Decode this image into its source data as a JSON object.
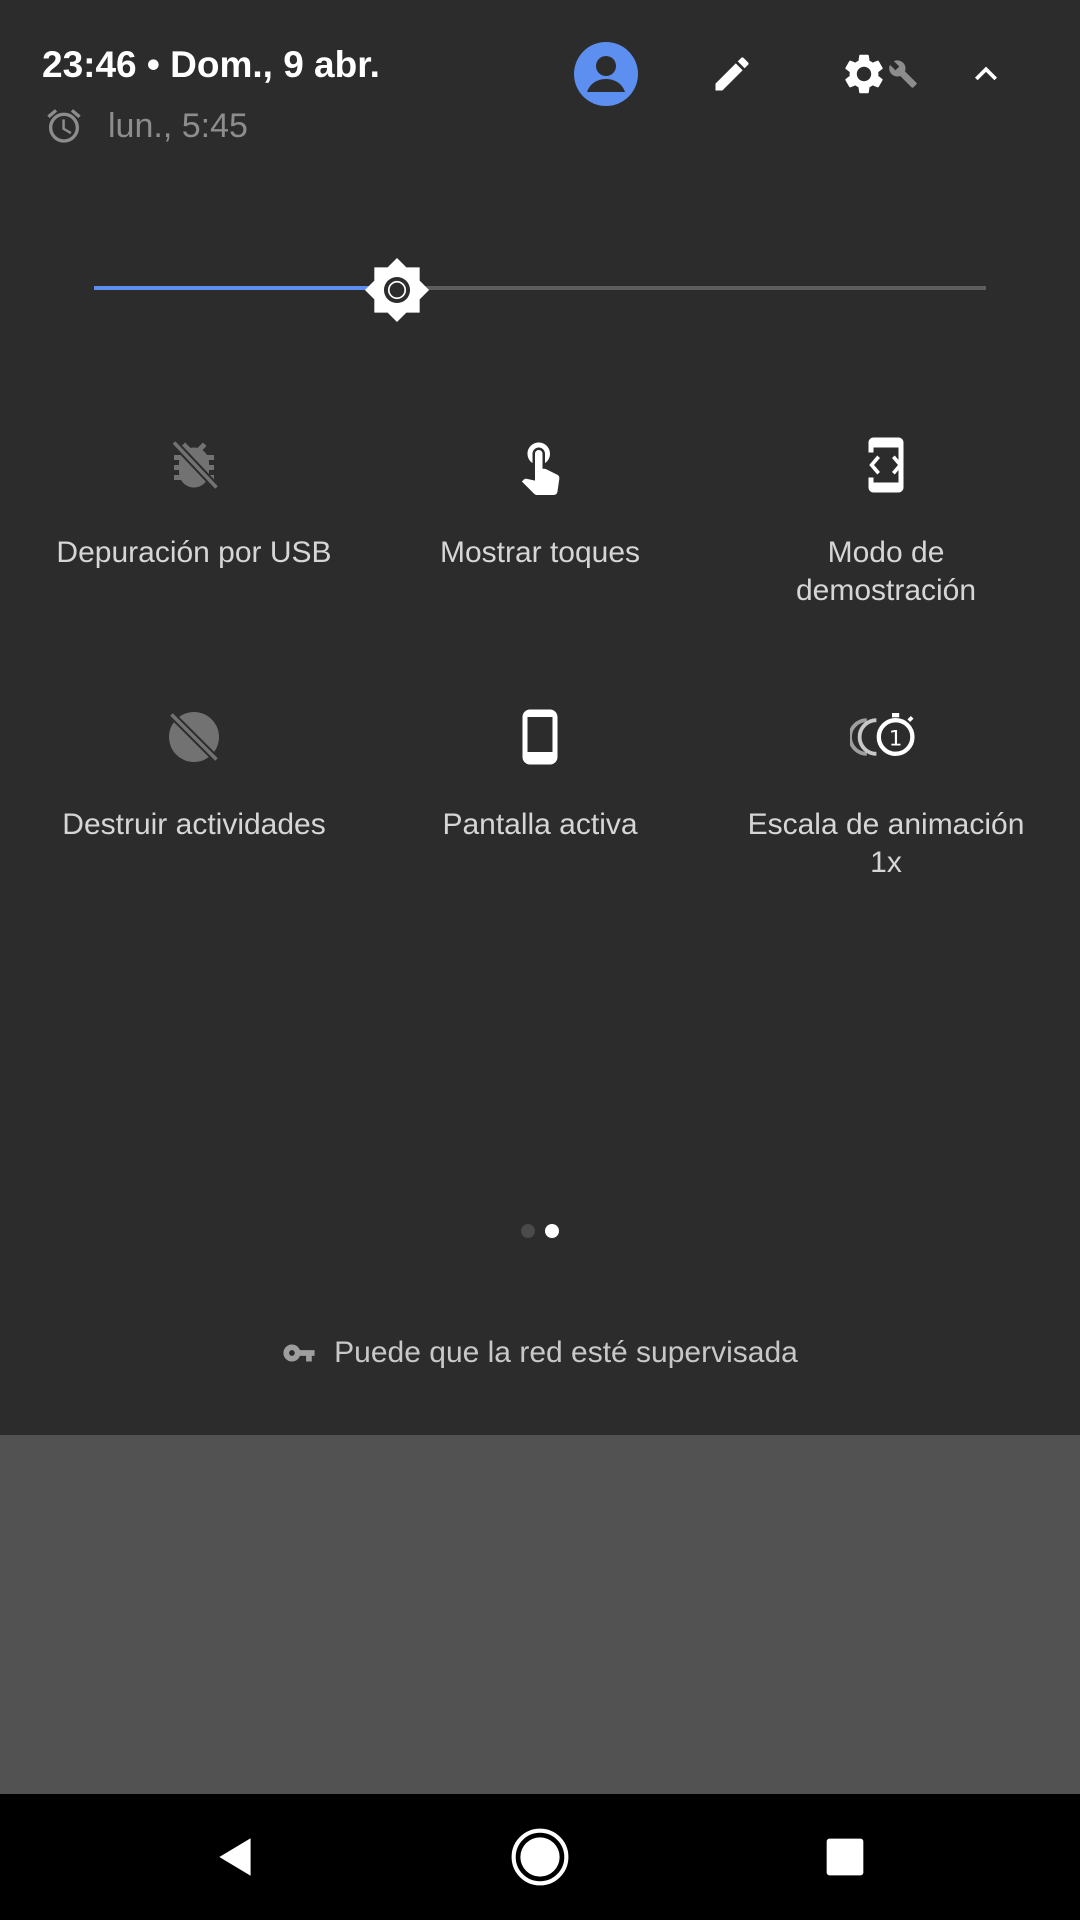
{
  "header": {
    "time_date": "23:46 • Dom., 9 abr.",
    "alarm_text": "lun., 5:45",
    "icons": [
      "account-icon",
      "edit-icon",
      "settings-icon",
      "wrench-icon",
      "collapse-icon"
    ]
  },
  "brightness": {
    "level": 0.34,
    "fill_color": "#5c8ff0",
    "track_color": "#5e5e5e"
  },
  "tiles": [
    {
      "label": "Depuración por USB",
      "icon": "usb-debug-off-icon",
      "active": false
    },
    {
      "label": "Mostrar toques",
      "icon": "touch-icon",
      "active": true
    },
    {
      "label": "Modo de\ndemostración",
      "icon": "demo-mode-icon",
      "active": true
    },
    {
      "label": "Destruir actividades",
      "icon": "destroy-activities-off-icon",
      "active": false
    },
    {
      "label": "Pantalla activa",
      "icon": "phone-icon",
      "active": true
    },
    {
      "label": "Escala de animación\n1x",
      "icon": "animation-scale-icon",
      "active": true
    }
  ],
  "pager": {
    "total": 2,
    "current": 2
  },
  "network_notice": "Puede que la red esté supervisada",
  "navbar": {
    "buttons": [
      "back-icon",
      "home-icon",
      "recents-icon"
    ]
  },
  "colors": {
    "panel": "#2c2c2d",
    "scrim": "#525252",
    "accent": "#5c8ff0"
  }
}
